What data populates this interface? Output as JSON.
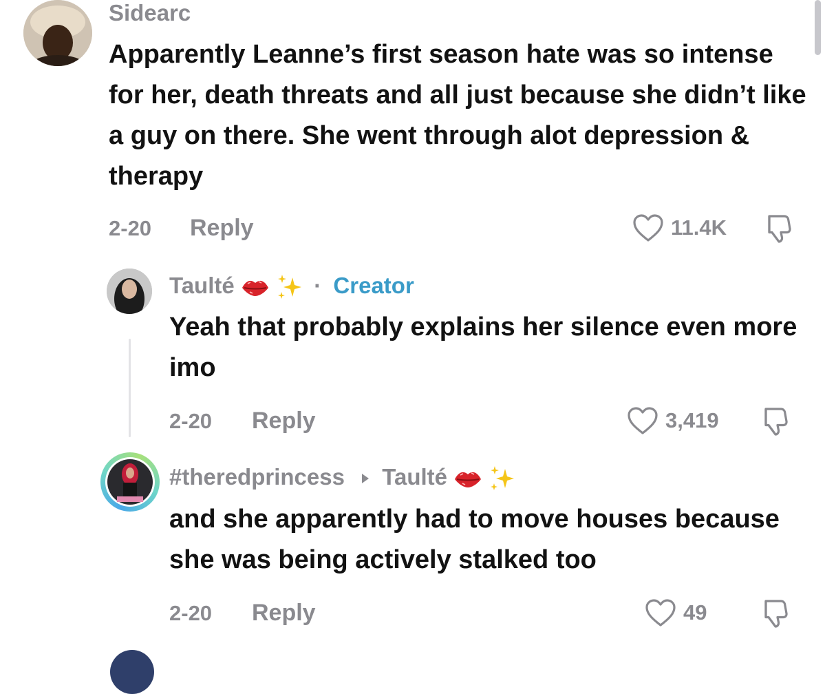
{
  "comments": [
    {
      "username": "Sidearc",
      "text": "Apparently Leanne’s first season hate was so intense for her, death threats and all just because she didn’t like a guy on there. She went through alot depression & therapy",
      "date": "2-20",
      "reply_label": "Reply",
      "likes": "11.4K"
    },
    {
      "username": "Taulté",
      "creator_label": "Creator",
      "separator": "·",
      "text": "Yeah that probably explains her silence even more imo",
      "date": "2-20",
      "reply_label": "Reply",
      "likes": "3,419"
    },
    {
      "username": "#theredprincess",
      "reply_to": "Taulté",
      "text": "and she apparently had to move houses because she was being actively stalked too",
      "date": "2-20",
      "reply_label": "Reply",
      "likes": "49"
    }
  ],
  "icons": {
    "like": "heart-outline-icon",
    "dislike": "thumbs-down-icon",
    "lips": "kiss-lips-icon",
    "sparkles": "sparkles-icon",
    "reply_arrow": "caret-right-icon"
  },
  "colors": {
    "text": "#121212",
    "muted": "#8a8a8f",
    "creator": "#3a9bc8",
    "lips": "#d8232a",
    "sparkles": "#f5c518"
  }
}
